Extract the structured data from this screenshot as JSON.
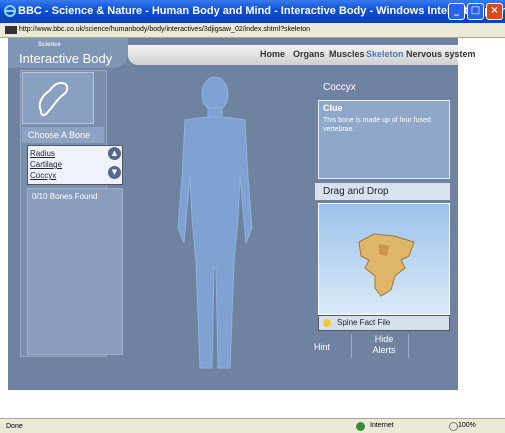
{
  "window": {
    "title": "BBC - Science & Nature - Human Body and Mind - Interactive Body - Windows Internet Explorer",
    "url": "http://www.bbc.co.uk/science/humanbody/body/interactives/3djigsaw_02/index.shtml?skeleton"
  },
  "logo": {
    "small": "Science",
    "main": "Interactive Body"
  },
  "nav": {
    "items": [
      "Home",
      "Organs",
      "Muscles",
      "Skeleton",
      "Nervous system"
    ],
    "active": "Skeleton"
  },
  "left": {
    "choose_label": "Choose A Bone",
    "bones": [
      "Radius",
      "Cartilage",
      "Coccyx"
    ],
    "found": "0/10 Bones Found"
  },
  "right": {
    "selected": "Coccyx",
    "clue_title": "Clue",
    "clue_text": "This bone is made up of four fused vertebrae.",
    "drag_title": "Drag and Drop",
    "fact_button": "Spine Fact File",
    "hint": "Hint",
    "hide_alerts": "Hide Alerts"
  },
  "status": {
    "left": "Done",
    "zone": "Internet",
    "zoom": "100%"
  },
  "colors": {
    "panel": "#6f83a0",
    "body": "#7fa2d2",
    "accent": "#4f79b8"
  }
}
